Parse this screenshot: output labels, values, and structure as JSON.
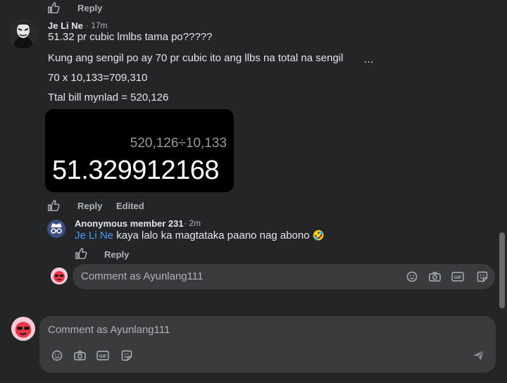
{
  "top_actions": {
    "reply_label": "Reply"
  },
  "comment": {
    "author": "Je Li Ne",
    "time": "· 17m",
    "lines": [
      "51.32 pr cubic lmlbs tama po?????",
      "Kung ang sengil po ay 70 pr cubic ito ang llbs na total na sengil",
      "70 x 10,133=709,310",
      "Ttal bill mynlad = 520,126"
    ],
    "more": "…",
    "calculator": {
      "expression": "520,126÷10,133",
      "result": "51.329912168"
    },
    "actions": {
      "reply_label": "Reply",
      "edited_label": "Edited"
    }
  },
  "reply": {
    "author": "Anonymous member 231",
    "time": "· 2m",
    "mention": "Je Li Ne",
    "text": " kaya lalo ka magtataka paano nag abono",
    "emoji": "🤣",
    "actions": {
      "reply_label": "Reply"
    }
  },
  "reply_composer": {
    "placeholder": "Comment as Ayunlang111"
  },
  "main_composer": {
    "placeholder": "Comment as Ayunlang111"
  },
  "icons": {
    "like": "thumbs-up-icon",
    "emoji": "smiley-icon",
    "camera": "camera-icon",
    "gif": "gif-icon",
    "sticker": "sticker-icon",
    "send": "send-icon"
  },
  "colors": {
    "background": "#242526",
    "composer_bg": "#3a3b3c",
    "mention": "#4599ff",
    "muted": "#b0b3b8"
  }
}
